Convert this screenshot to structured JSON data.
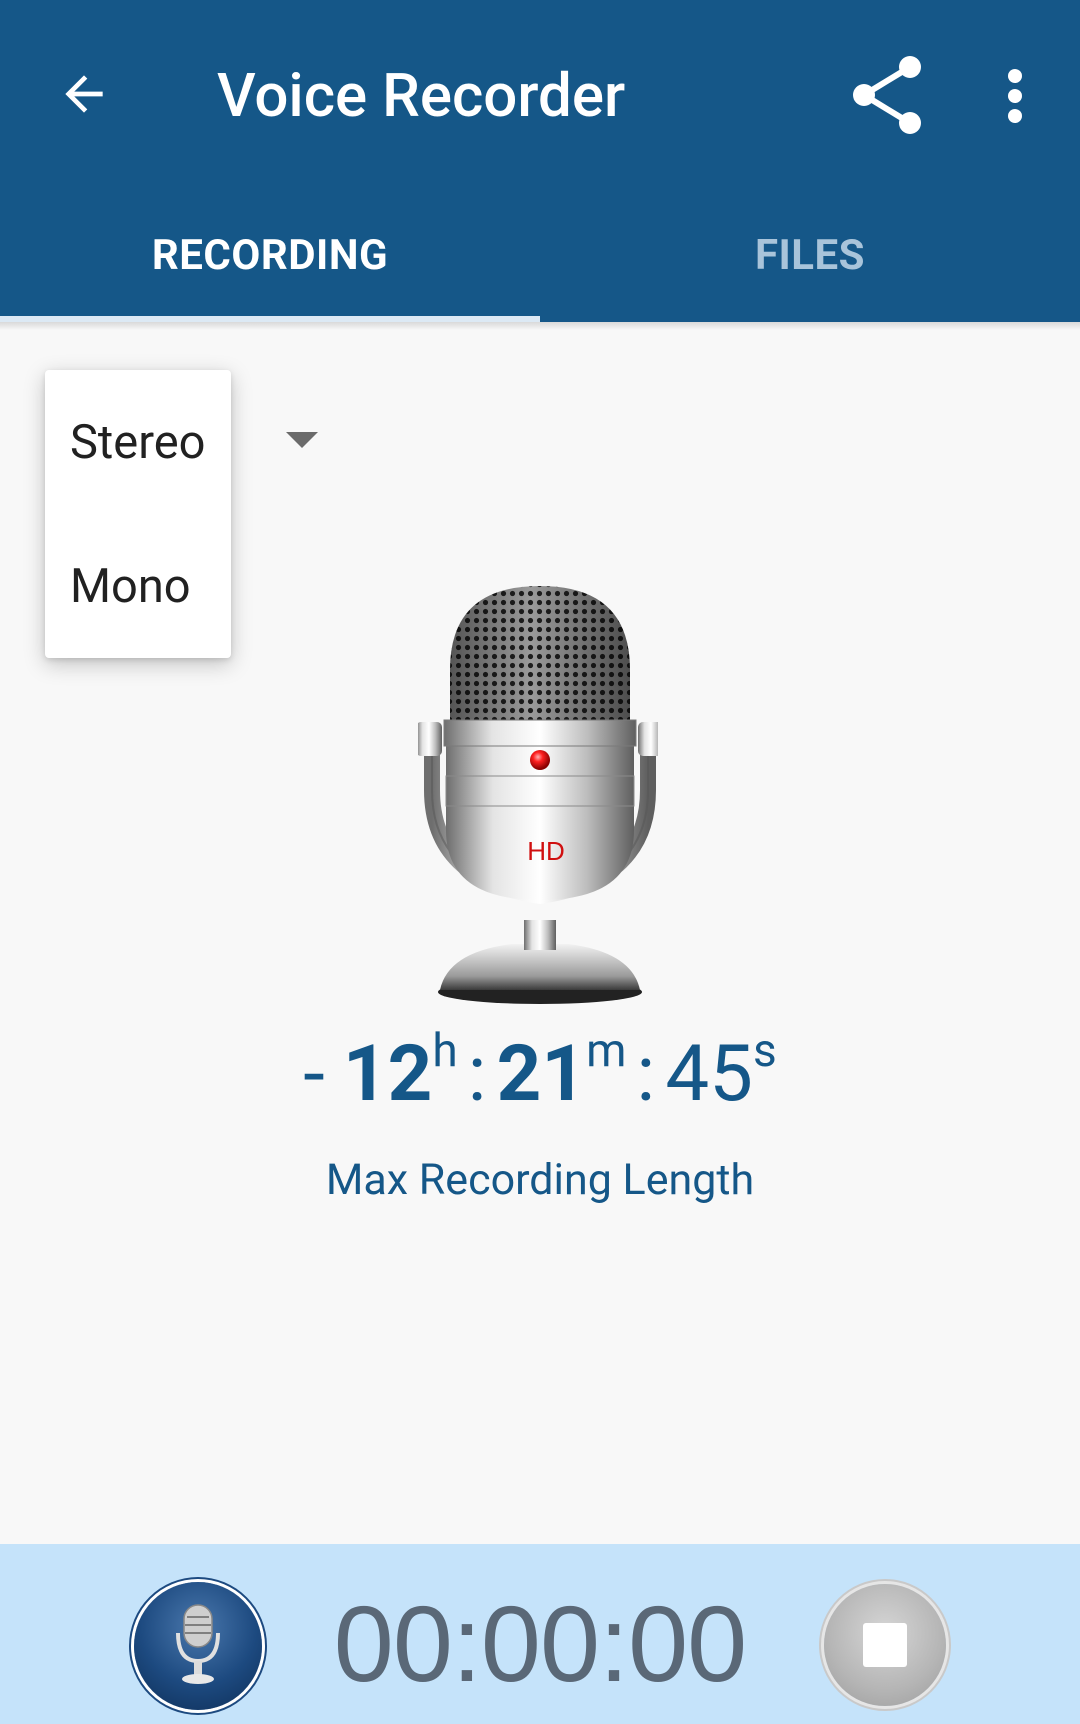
{
  "app_bar": {
    "title": "Voice Recorder",
    "background_color": "#155788",
    "icons": [
      "back-arrow-icon",
      "share-icon",
      "more-vert-icon"
    ]
  },
  "tabs": [
    {
      "label": "RECORDING",
      "selected": true
    },
    {
      "label": "FILES",
      "selected": false
    }
  ],
  "channel_dropdown": {
    "options": [
      "Stereo",
      "Mono"
    ],
    "expanded": true
  },
  "microphone": {
    "badge": "HD"
  },
  "remaining_time": {
    "prefix": "-",
    "hours": "12",
    "hours_unit": "h",
    "minutes": "21",
    "minutes_unit": "m",
    "seconds": "45",
    "seconds_unit": "s",
    "separator": ":",
    "label": "Max Recording Length"
  },
  "bottom_bar": {
    "timer": "00:00:00",
    "background_color": "#c5e3fa",
    "icons": [
      "record-mic-icon",
      "stop-icon"
    ]
  }
}
